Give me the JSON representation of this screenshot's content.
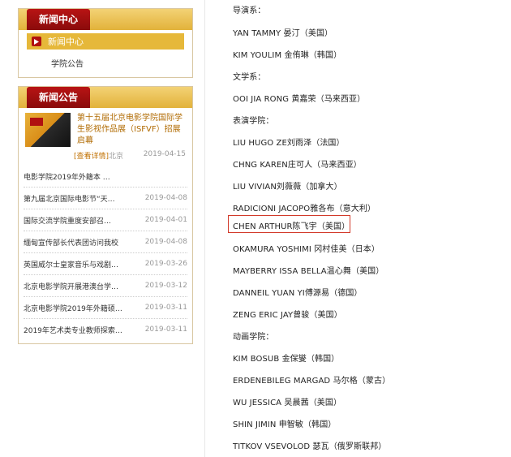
{
  "sidebar": {
    "news_center": {
      "title": "新闻中心",
      "active_item": "新闻中心",
      "sub_item": "学院公告"
    },
    "news_notice": {
      "title": "新闻公告",
      "featured": {
        "text": "第十五届北京电影学院国际学生影视作品展（ISFVF）招展启幕",
        "more_label": "[查看详情]",
        "source": "北京",
        "date": "2019-04-15"
      },
      "items": [
        {
          "title": "电影学院2019年外籍本 …",
          "date": ""
        },
        {
          "title": "第九届北京国际电影节“天…",
          "date": "2019-04-08"
        },
        {
          "title": "国际交流学院重度安部召…",
          "date": "2019-04-01"
        },
        {
          "title": "缅甸宣传部长代表团访问我校",
          "date": "2019-04-08"
        },
        {
          "title": "英国威尔士皇家音乐与戏剧…",
          "date": "2019-03-26"
        },
        {
          "title": "北京电影学院开展港澳台学…",
          "date": "2019-03-12"
        },
        {
          "title": "北京电影学院2019年外籍硕…",
          "date": "2019-03-11"
        },
        {
          "title": "2019年艺术类专业教师探索…",
          "date": "2019-03-11"
        }
      ]
    }
  },
  "content": {
    "lines": [
      "导演系：",
      "YAN TAMMY 晏汀（美国）",
      "KIM YOULIM 金侑琳（韩国）",
      "文学系：",
      "OOI JIA RONG 黄嘉荣（马来西亚）",
      "表演学院：",
      "LIU HUGO ZE刘雨泽（法国）",
      "CHNG KAREN庄可人（马来西亚）",
      "LIU VIVIAN刘薇薇（加拿大）",
      "RADICIONI JACOPO雅各布（意大利）",
      "CHEN ARTHUR陈飞宇（美国）",
      "OKAMURA YOSHIMI 冈村佳美（日本）",
      "MAYBERRY ISSA BELLA温心舞（美国）",
      "DANNEIL YUAN YI傅源易（德国）",
      "ZENG ERIC JAY曾骏（美国）",
      "动画学院：",
      "KIM BOSUB 金保燮（韩国）",
      "ERDENEBILEG MARGAD 马尔格（蒙古）",
      "WU JESSICA 吴晨茜（美国）",
      "SHIN JIMIN 申智敏（韩国）",
      "TITKOV VSEVOLOD 瑟瓦（俄罗斯联邦）"
    ]
  },
  "colors": {
    "tab_red": "#b81414",
    "header_gold": "#e2b23a",
    "highlight_border": "#d23a2a"
  }
}
